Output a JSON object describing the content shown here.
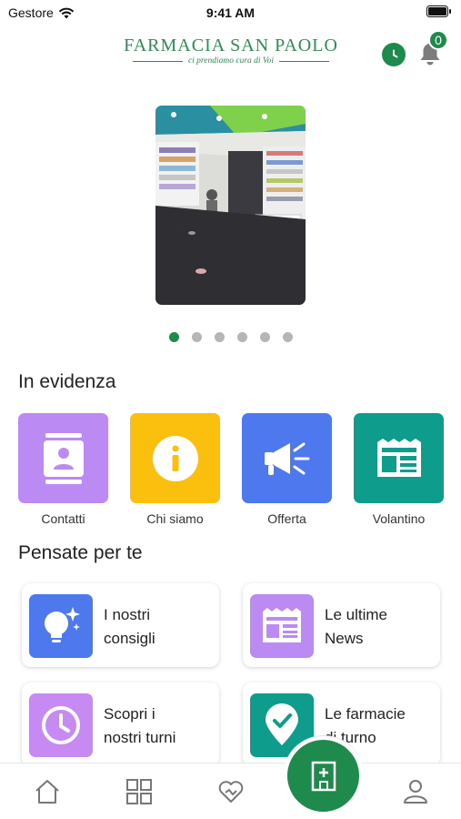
{
  "status_bar": {
    "carrier": "Gestore",
    "time": "9:41 AM"
  },
  "header": {
    "logo_name": "FARMACIA SAN PAOLO",
    "logo_tagline": "ci prendiamo cura di Voi",
    "notifications_count": "0",
    "clock_icon": "clock-icon",
    "bell_icon": "bell-icon"
  },
  "carousel": {
    "slides": 6,
    "active_slide": 1
  },
  "highlights": {
    "title": "In evidenza",
    "items": [
      {
        "label": "Contatti",
        "icon": "contact-book-icon",
        "color": "#bb8af2"
      },
      {
        "label": "Chi siamo",
        "icon": "info-icon",
        "color": "#fbbf0d"
      },
      {
        "label": "Offerta",
        "icon": "megaphone-icon",
        "color": "#4e78ee"
      },
      {
        "label": "Volantino",
        "icon": "flyer-icon",
        "color": "#0e9c8c"
      }
    ]
  },
  "for_you": {
    "title": "Pensate per te",
    "cards": [
      {
        "line1": "I nostri",
        "line2": "consigli",
        "icon": "lightbulb-icon",
        "color": "#4e78ee"
      },
      {
        "line1": "Le ultime",
        "line2": "News",
        "icon": "news-icon",
        "color": "#bb8af2"
      },
      {
        "line1": "Scopri i",
        "line2": "nostri turni",
        "icon": "clock-icon",
        "color": "#c68af2"
      },
      {
        "line1": "Le farmacie",
        "line2": "di turno",
        "icon": "location-check-icon",
        "color": "#0e9c8c"
      }
    ]
  },
  "bottom_nav": {
    "items": [
      "home-icon",
      "grid-icon",
      "heart-icon",
      "pharmacy-icon",
      "profile-icon"
    ],
    "accent": "#1e8a4c"
  }
}
